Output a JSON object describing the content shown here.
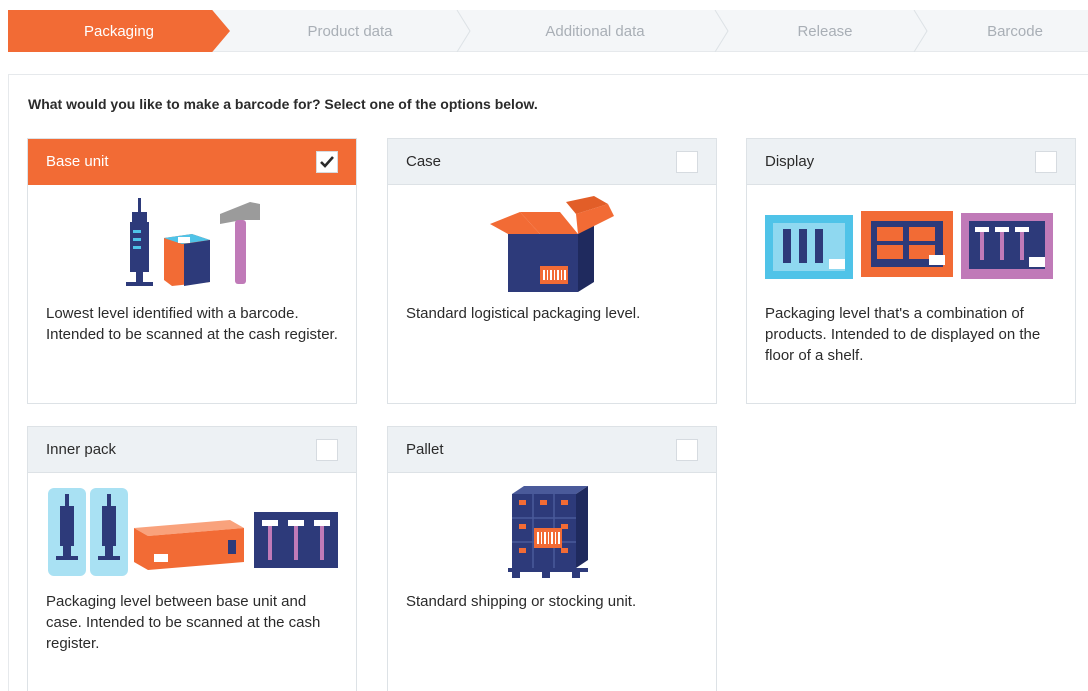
{
  "stepper": {
    "steps": [
      {
        "label": "Packaging",
        "active": true
      },
      {
        "label": "Product data",
        "active": false
      },
      {
        "label": "Additional data",
        "active": false
      },
      {
        "label": "Release",
        "active": false
      },
      {
        "label": "Barcode",
        "active": false
      }
    ]
  },
  "question": "What would you like to make a barcode for? Select one of the options below.",
  "options": [
    {
      "title": "Base unit",
      "checked": true,
      "description": "Lowest level identified with a barcode. Intended to be scanned at the cash register."
    },
    {
      "title": "Case",
      "checked": false,
      "description": "Standard logistical packaging level."
    },
    {
      "title": "Display",
      "checked": false,
      "description": "Packaging level that's a combination of products. Intended to de displayed on the floor of a shelf."
    },
    {
      "title": "Inner pack",
      "checked": false,
      "description": "Packaging level between base unit and case. Intended to be scanned at the cash register."
    },
    {
      "title": "Pallet",
      "checked": false,
      "description": "Standard shipping or stocking unit."
    }
  ],
  "colors": {
    "accent": "#f26b35",
    "navy": "#2d3a7a",
    "cyan": "#4fc3e8",
    "purple": "#c07ab8",
    "gray": "#9b9b9b"
  }
}
